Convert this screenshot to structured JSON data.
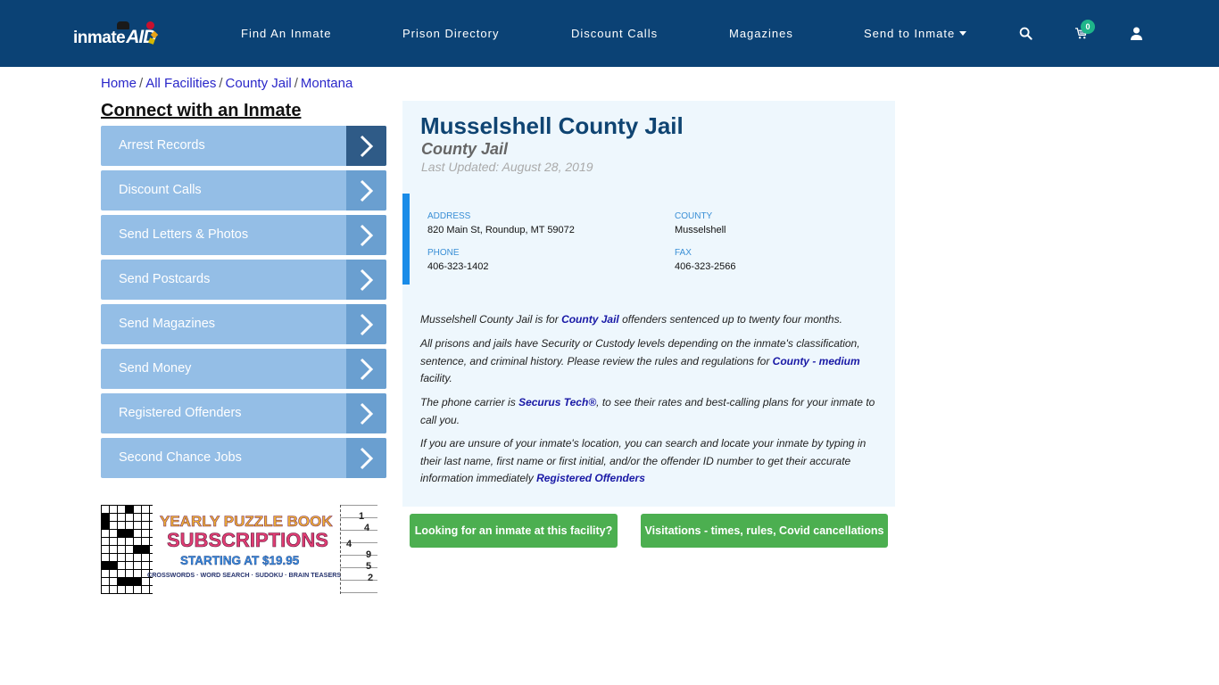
{
  "header": {
    "logo": {
      "text": "inmate",
      "accent": "AID"
    },
    "nav": [
      {
        "label": "Find An Inmate"
      },
      {
        "label": "Prison Directory"
      },
      {
        "label": "Discount Calls"
      },
      {
        "label": "Magazines"
      },
      {
        "label": "Send to Inmate",
        "has_dropdown": true
      }
    ],
    "icons": {
      "search": "search-icon",
      "cart": "cart-icon",
      "account": "user-icon"
    },
    "cart_count": "0",
    "colors": {
      "bar": "#0b4275",
      "badge": "#1fb58a"
    }
  },
  "breadcrumb": [
    {
      "label": "Home"
    },
    {
      "label": "All Facilities"
    },
    {
      "label": "County Jail"
    },
    {
      "label": "Montana"
    }
  ],
  "breadcrumb_separator": "/",
  "sidebar": {
    "title": "Connect with an Inmate",
    "items": [
      {
        "label": "Arrest Records"
      },
      {
        "label": "Discount Calls"
      },
      {
        "label": "Send Letters & Photos"
      },
      {
        "label": "Send Postcards"
      },
      {
        "label": "Send Magazines"
      },
      {
        "label": "Send Money"
      },
      {
        "label": "Registered Offenders"
      },
      {
        "label": "Second Chance Jobs"
      }
    ],
    "ad": {
      "line1": "YEARLY PUZZLE BOOK",
      "line2": "SUBSCRIPTIONS",
      "line3": "STARTING AT $19.95",
      "line4": "CROSSWORDS · WORD SEARCH · SUDOKU · BRAIN TEASERS",
      "sudoku_digits": [
        "1",
        "4",
        "4",
        "9",
        "5",
        "2"
      ]
    }
  },
  "facility": {
    "name": "Musselshell County Jail",
    "type": "County Jail",
    "last_updated": "Last Updated: August 28, 2019",
    "info": {
      "address_label": "ADDRESS",
      "address": "820 Main St, Roundup, MT 59072",
      "county_label": "COUNTY",
      "county": "Musselshell",
      "phone_label": "PHONE",
      "phone": "406-323-1402",
      "fax_label": "FAX",
      "fax": "406-323-2566"
    },
    "description": {
      "p1_pre": "Musselshell County Jail is for ",
      "p1_link": "County Jail",
      "p1_post": " offenders sentenced up to twenty four months.",
      "p2_pre": "All prisons and jails have Security or Custody levels depending on the inmate's classification, sentence, and criminal history. Please review the rules and regulations for ",
      "p2_link": "County - medium",
      "p2_post": " facility.",
      "p3_pre": "The phone carrier is ",
      "p3_link": "Securus Tech®",
      "p3_post": ", to see their rates and best-calling plans for your inmate to call you.",
      "p4_pre": "If you are unsure of your inmate's location, you can search and locate your inmate by typing in their last name, first name or first initial, and/or the offender ID number to get their accurate information immediately ",
      "p4_link": "Registered Offenders"
    },
    "buttons": {
      "find_inmate": "Looking for an inmate at this facility?",
      "visitations": "Visitations - times, rules, Covid cancellations"
    },
    "colors": {
      "title": "#0f4472",
      "accent_bar": "#1a8ce8",
      "button": "#4caf50",
      "link": "#1919a6"
    }
  }
}
